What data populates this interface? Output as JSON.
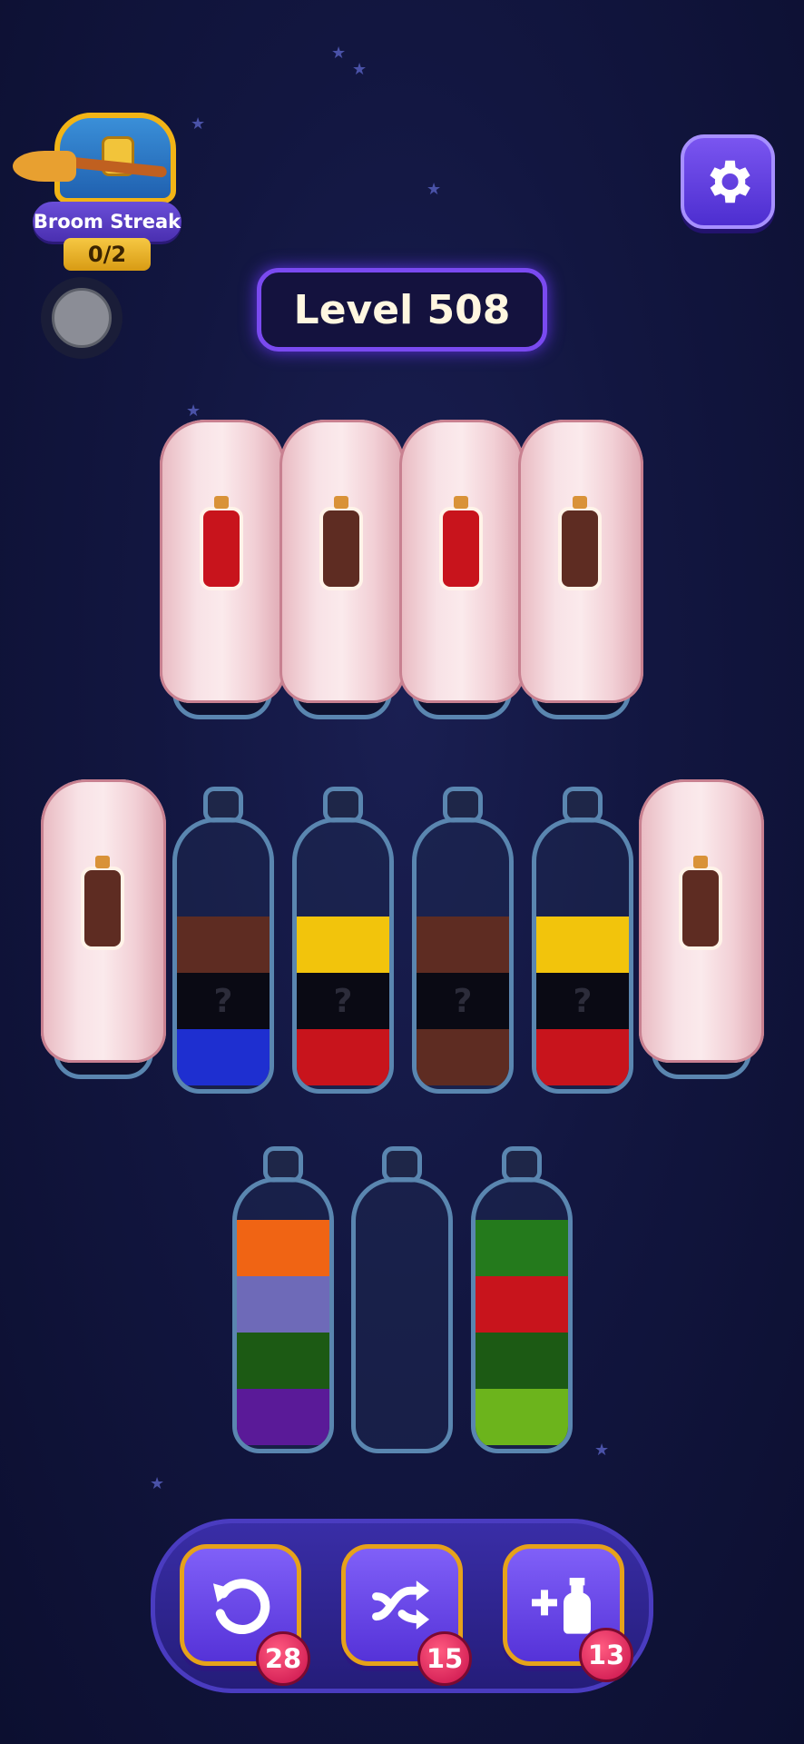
{
  "header": {
    "streak_label": "Broom Streak",
    "streak_count": "0/2",
    "level_label": "Level 508",
    "settings_icon": "gear-icon"
  },
  "colors": {
    "red": "#c8141c",
    "brown": "#5e2c22",
    "blue": "#1e2fd0",
    "yellow": "#f2c40c",
    "black": "#0a0a14",
    "orange": "#f06414",
    "lavender": "#6e6ab8",
    "dark_green": "#1c5a14",
    "purple": "#5a1a98",
    "green": "#247a1c",
    "lime": "#6cb41c"
  },
  "covered_row1": [
    {
      "potion_color": "red"
    },
    {
      "potion_color": "brown"
    },
    {
      "potion_color": "red"
    },
    {
      "potion_color": "brown"
    }
  ],
  "row2": [
    {
      "covered": true,
      "potion_color": "brown"
    },
    {
      "covered": false,
      "layers": [
        "brown",
        "hidden",
        "blue"
      ]
    },
    {
      "covered": false,
      "layers": [
        "yellow",
        "hidden",
        "red"
      ]
    },
    {
      "covered": false,
      "layers": [
        "brown",
        "hidden",
        "brown"
      ]
    },
    {
      "covered": false,
      "layers": [
        "yellow",
        "hidden",
        "red"
      ]
    },
    {
      "covered": true,
      "potion_color": "brown"
    }
  ],
  "row3": [
    {
      "layers": [
        "orange",
        "lavender",
        "dark_green",
        "purple"
      ]
    },
    {
      "layers": []
    },
    {
      "layers": [
        "green",
        "red",
        "dark_green",
        "lime"
      ]
    }
  ],
  "hidden_mark": "?",
  "toolbar": {
    "undo_icon": "undo-icon",
    "undo_count": "28",
    "shuffle_icon": "shuffle-icon",
    "shuffle_count": "15",
    "add_bottle_icon": "add-bottle-icon",
    "add_bottle_count": "13"
  }
}
